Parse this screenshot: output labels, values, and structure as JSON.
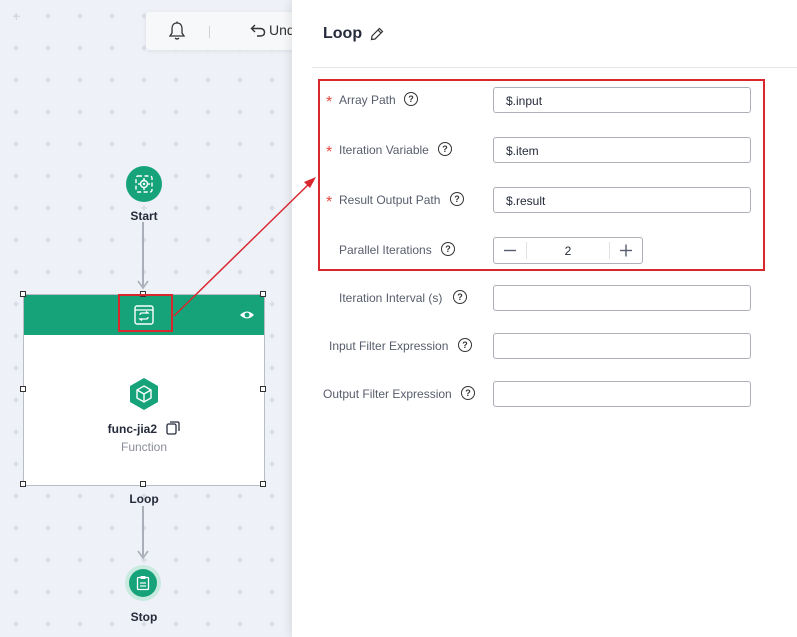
{
  "toolbar": {
    "undo_label": "Und"
  },
  "flow": {
    "start_label": "Start",
    "loop_label": "Loop",
    "stop_label": "Stop",
    "function_name": "func-jia2",
    "function_type": "Function"
  },
  "panel": {
    "title": "Loop",
    "fields": {
      "array_path": {
        "label": "Array Path",
        "value": "$.input",
        "required": true
      },
      "iteration_variable": {
        "label": "Iteration Variable",
        "value": "$.item",
        "required": true
      },
      "result_output_path": {
        "label": "Result Output Path",
        "value": "$.result",
        "required": true
      },
      "parallel_iterations": {
        "label": "Parallel Iterations",
        "value": "2"
      },
      "iteration_interval": {
        "label": "Iteration Interval (s)",
        "value": ""
      },
      "input_filter": {
        "label": "Input Filter Expression",
        "value": ""
      },
      "output_filter": {
        "label": "Output Filter Expression",
        "value": ""
      }
    },
    "required_mark": "*",
    "help_mark": "?"
  },
  "colors": {
    "brand_green": "#17a37a",
    "highlight_red": "#d9272e",
    "required_red": "#e5473f"
  }
}
